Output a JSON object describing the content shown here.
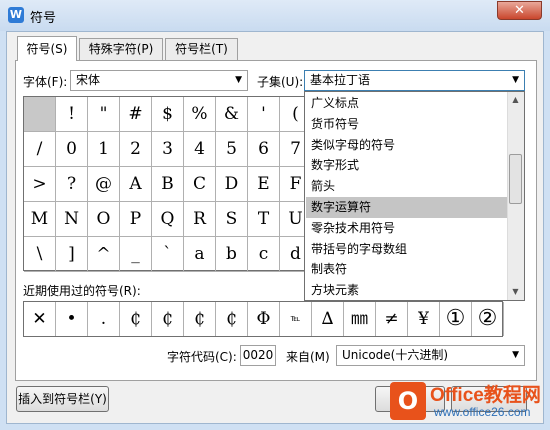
{
  "window": {
    "title": "符号",
    "app_icon_glyph": "W",
    "close_glyph": "✕"
  },
  "tabs": [
    "符号(S)",
    "特殊字符(P)",
    "符号栏(T)"
  ],
  "font": {
    "label": "字体(F):",
    "value": "宋体"
  },
  "subset": {
    "label": "子集(U):",
    "value": "基本拉丁语",
    "options": [
      "广义标点",
      "货币符号",
      "类似字母的符号",
      "数字形式",
      "箭头",
      "数字运算符",
      "零杂技术用符号",
      "带括号的字母数组",
      "制表符",
      "方块元素"
    ],
    "highlighted": "数字运算符"
  },
  "symbol_grid": [
    [
      "",
      "!",
      "\"",
      "#",
      "$",
      "%",
      "&",
      "'",
      "("
    ],
    [
      "/",
      "0",
      "1",
      "2",
      "3",
      "4",
      "5",
      "6",
      "7"
    ],
    [
      ">",
      "?",
      "@",
      "A",
      "B",
      "C",
      "D",
      "E",
      "F"
    ],
    [
      "M",
      "N",
      "O",
      "P",
      "Q",
      "R",
      "S",
      "T",
      "U"
    ],
    [
      "\\",
      "]",
      "^",
      "_",
      "`",
      "a",
      "b",
      "c",
      "d"
    ]
  ],
  "recent_label": "近期使用过的符号(R):",
  "recent_symbols": [
    "✕",
    "•",
    ".",
    "₵",
    "₵",
    "₵",
    "₵",
    "Φ",
    "℡",
    "∆",
    "㎜",
    "≠",
    "¥",
    "①",
    "②"
  ],
  "code": {
    "label": "字符代码(C):",
    "value": "0020",
    "from_label": "来自(M)",
    "from_value": "Unicode(十六进制)"
  },
  "buttons": {
    "insert_to_bar": "插入到符号栏(Y)"
  },
  "watermark": {
    "icon": "O",
    "line1": "Office教程网",
    "line2": "www.office26.com"
  },
  "colors": {
    "highlight": "#c5c5c5",
    "watermark_orange": "#e8521b",
    "watermark_blue": "#2d6fb7"
  }
}
